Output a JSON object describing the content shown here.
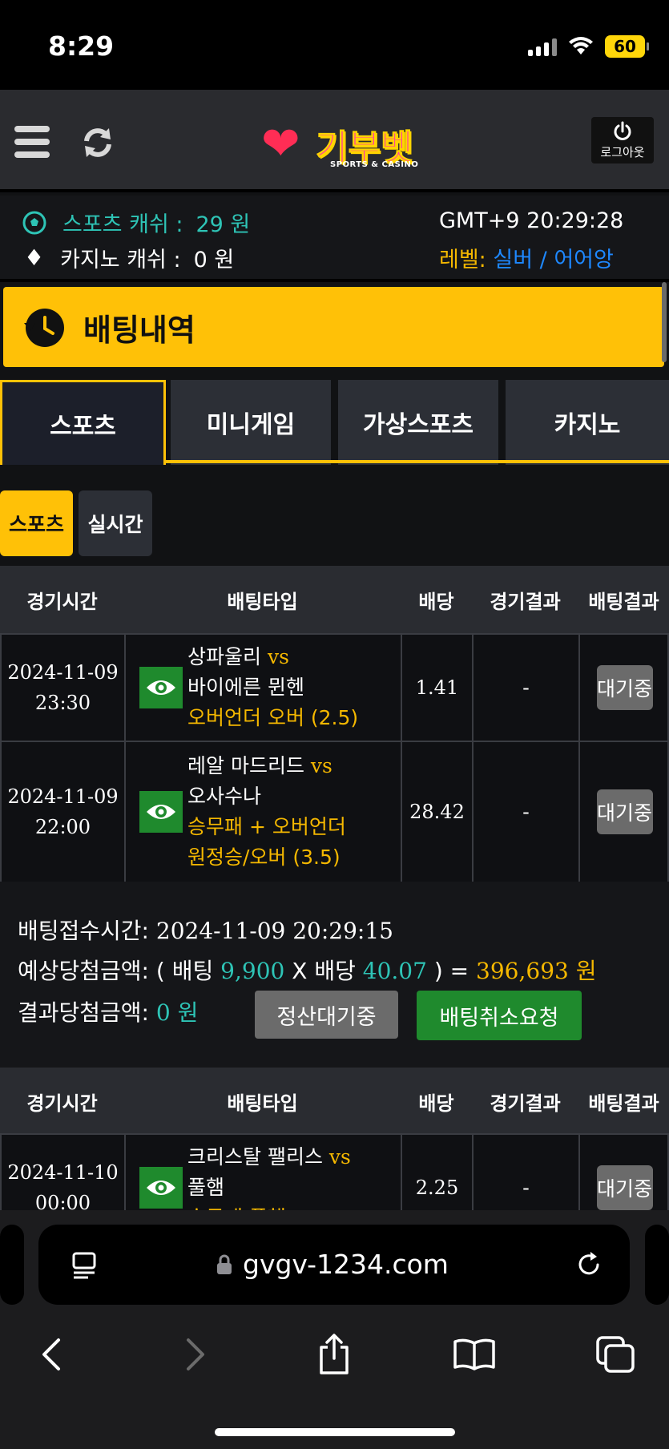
{
  "status_bar": {
    "time": "8:29",
    "battery": "60"
  },
  "header": {
    "logo_text": "기부벳",
    "logo_sub": "SPORTS & CASINO",
    "logout_label": "로그아웃"
  },
  "info": {
    "sports_label": "스포츠 캐쉬 :",
    "sports_value": "29 원",
    "casino_label": "카지노 캐쉬 :",
    "casino_value": "0 원",
    "server_time": "GMT+9 20:29:28",
    "level_label": "레벨:",
    "level_value": "실버 / 어어앙"
  },
  "page_title": "배팅내역",
  "main_tabs": [
    "스포츠",
    "미니게임",
    "가상스포츠",
    "카지노"
  ],
  "sub_tabs": [
    "스포츠",
    "실시간"
  ],
  "table_headers": [
    "경기시간",
    "배팅타입",
    "배당",
    "경기결과",
    "배팅결과"
  ],
  "bet_slip_1": {
    "rows": [
      {
        "date": "2024-11-09",
        "time": "23:30",
        "home": "상파울리",
        "vs": "vs",
        "away": "바이에른 뮌헨",
        "market": "오버언더 오버 (2.5)",
        "market2": "",
        "odds": "1.41",
        "result": "-",
        "status": "대기중"
      },
      {
        "date": "2024-11-09",
        "time": "22:00",
        "home": "레알 마드리드",
        "vs": "vs",
        "away": "오사수나",
        "market": "승무패 + 오버언더",
        "market2": "원정승/오버 (3.5)",
        "odds": "28.42",
        "result": "-",
        "status": "대기중"
      }
    ],
    "summary": {
      "received_label": "배팅접수시간:",
      "received_time": "2024-11-09 20:29:15",
      "expected_label": "예상당첨금액:",
      "open_paren": "( 배팅",
      "stake": "9,900",
      "times": "X 배당",
      "total_odds": "40.07",
      "close_eq": ") =",
      "expected_win": "396,693 원",
      "result_label": "결과당첨금액:",
      "result_win": "0 원",
      "settle_btn": "정산대기중",
      "cancel_btn": "배팅취소요청"
    }
  },
  "bet_slip_2": {
    "rows": [
      {
        "date": "2024-11-10",
        "time": "00:00",
        "home": "크리스탈 팰리스",
        "vs": "vs",
        "away": "풀햄",
        "market": "승무패 풀햄",
        "odds": "2.25",
        "result": "-",
        "status": "대기중"
      }
    ]
  },
  "browser": {
    "url": "gvgv-1234.com"
  },
  "colors": {
    "accent": "#ffc107",
    "green": "#1f8a2d",
    "teal": "#2ec4b6",
    "gold": "#f5b800",
    "blue": "#1e88ff"
  }
}
